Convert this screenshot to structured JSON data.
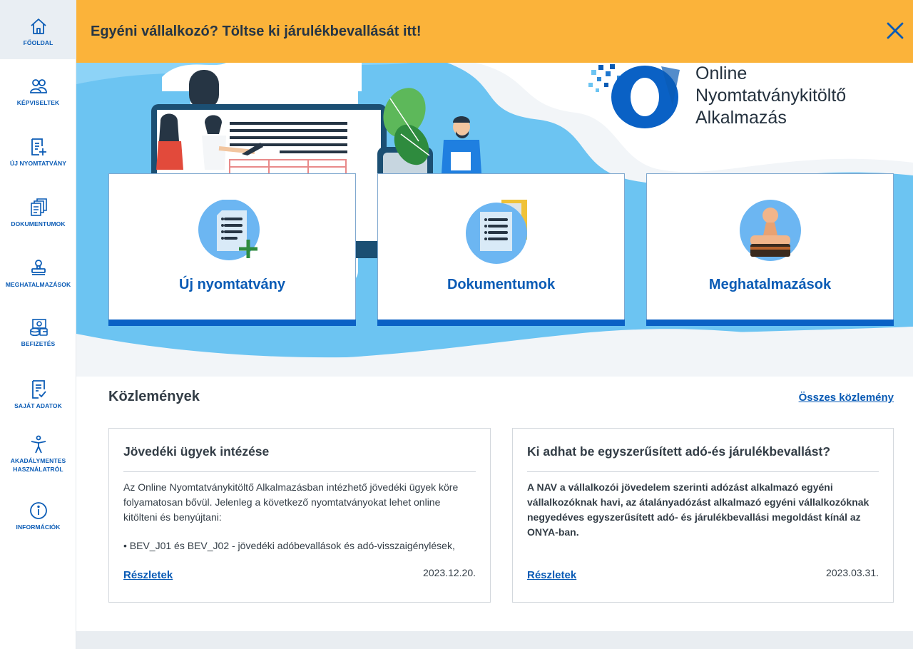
{
  "sidebar": {
    "items": [
      {
        "label": "FŐOLDAL",
        "icon": "home-icon"
      },
      {
        "label": "KÉPVISELTEK",
        "icon": "users-icon"
      },
      {
        "label": "ÚJ NYOMTATVÁNY",
        "icon": "new-form-icon"
      },
      {
        "label": "DOKUMENTUMOK",
        "icon": "documents-icon"
      },
      {
        "label": "MEGHATALMAZÁSOK",
        "icon": "stamp-icon"
      },
      {
        "label": "BEFIZETÉS",
        "icon": "payment-icon"
      },
      {
        "label": "SAJÁT ADATOK",
        "icon": "own-data-icon"
      },
      {
        "label": "AKADÁLYMENTES HASZNÁLATRÓL",
        "icon": "accessibility-icon"
      },
      {
        "label": "INFORMÁCIÓK",
        "icon": "info-icon"
      }
    ]
  },
  "banner": {
    "text": "Egyéni vállalkozó? Töltse ki járulékbevallását itt!",
    "close_icon": "close-icon"
  },
  "hero": {
    "logo_letter": "O",
    "logo_line1": "Online",
    "logo_line2": "Nyomtatványkitöltő",
    "logo_line3": "Alkalmazás"
  },
  "cards": [
    {
      "title": "Új nyomtatvány",
      "icon": "new-form-icon"
    },
    {
      "title": "Dokumentumok",
      "icon": "documents-icon"
    },
    {
      "title": "Meghatalmazások",
      "icon": "stamp-icon"
    }
  ],
  "announcements": {
    "title": "Közlemények",
    "all_link": "Összes közlemény",
    "items": [
      {
        "title": "Jövedéki ügyek intézése",
        "body": "Az Online Nyomtatványkitöltő Alkalmazásban intézhető jövedéki ügyek köre folyamatosan bővül. Jelenleg a következő nyomtatványokat lehet online kitölteni és benyújtani:",
        "bullet": "• BEV_J01 és BEV_J02 - jövedéki adóbevallások és adó-visszaigénylések,",
        "link": "Részletek",
        "date": "2023.12.20."
      },
      {
        "title": "Ki adhat be egyszerűsített adó-és járulékbevallást?",
        "body": "A NAV a vállalkozói jövedelem szerinti adózást alkalmazó egyéni vállalkozóknak havi, az átalányadózást alkalmazó egyéni vállalkozóknak negyedéves egyszerűsített adó- és járulékbevallási megoldást kínál az ONYA-ban.",
        "link": "Részletek",
        "date": "2023.03.31."
      }
    ]
  },
  "colors": {
    "primary": "#0a5bb5",
    "banner": "#fbb33a",
    "card_bar": "#0a61c5",
    "hero_sky": "#6cc4f2"
  }
}
